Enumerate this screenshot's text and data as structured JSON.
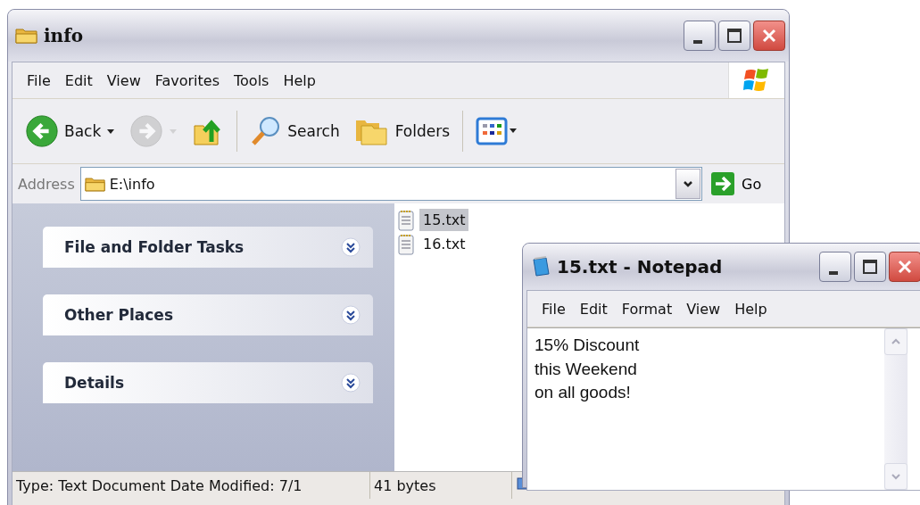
{
  "explorer": {
    "title": "info",
    "menu": [
      "File",
      "Edit",
      "View",
      "Favorites",
      "Tools",
      "Help"
    ],
    "toolbar": [
      {
        "kind": "back",
        "label": "Back",
        "disabled": false
      },
      {
        "kind": "forward",
        "disabled": true
      },
      {
        "kind": "up",
        "disabled": false
      },
      {
        "kind": "search",
        "label": "Search",
        "disabled": false
      },
      {
        "kind": "folders",
        "label": "Folders",
        "disabled": false
      },
      {
        "kind": "views",
        "disabled": false
      }
    ],
    "address": {
      "label": "Address",
      "value": "E:\\info",
      "go": "Go"
    },
    "task_panels": [
      {
        "title": "File and Folder Tasks",
        "expanded": false
      },
      {
        "title": "Other Places",
        "expanded": false
      },
      {
        "title": "Details",
        "expanded": false
      }
    ],
    "files": [
      {
        "name": "15.txt",
        "selected": true
      },
      {
        "name": "16.txt",
        "selected": false
      }
    ],
    "status_bar": [
      "Type: Text Document Date Modified: 7/1",
      "41 bytes"
    ]
  },
  "notepad": {
    "title": "15.txt - Notepad",
    "menu": [
      "File",
      "Edit",
      "Format",
      "View",
      "Help"
    ],
    "text": "15% Discount\nthis Weekend\non all goods!"
  }
}
